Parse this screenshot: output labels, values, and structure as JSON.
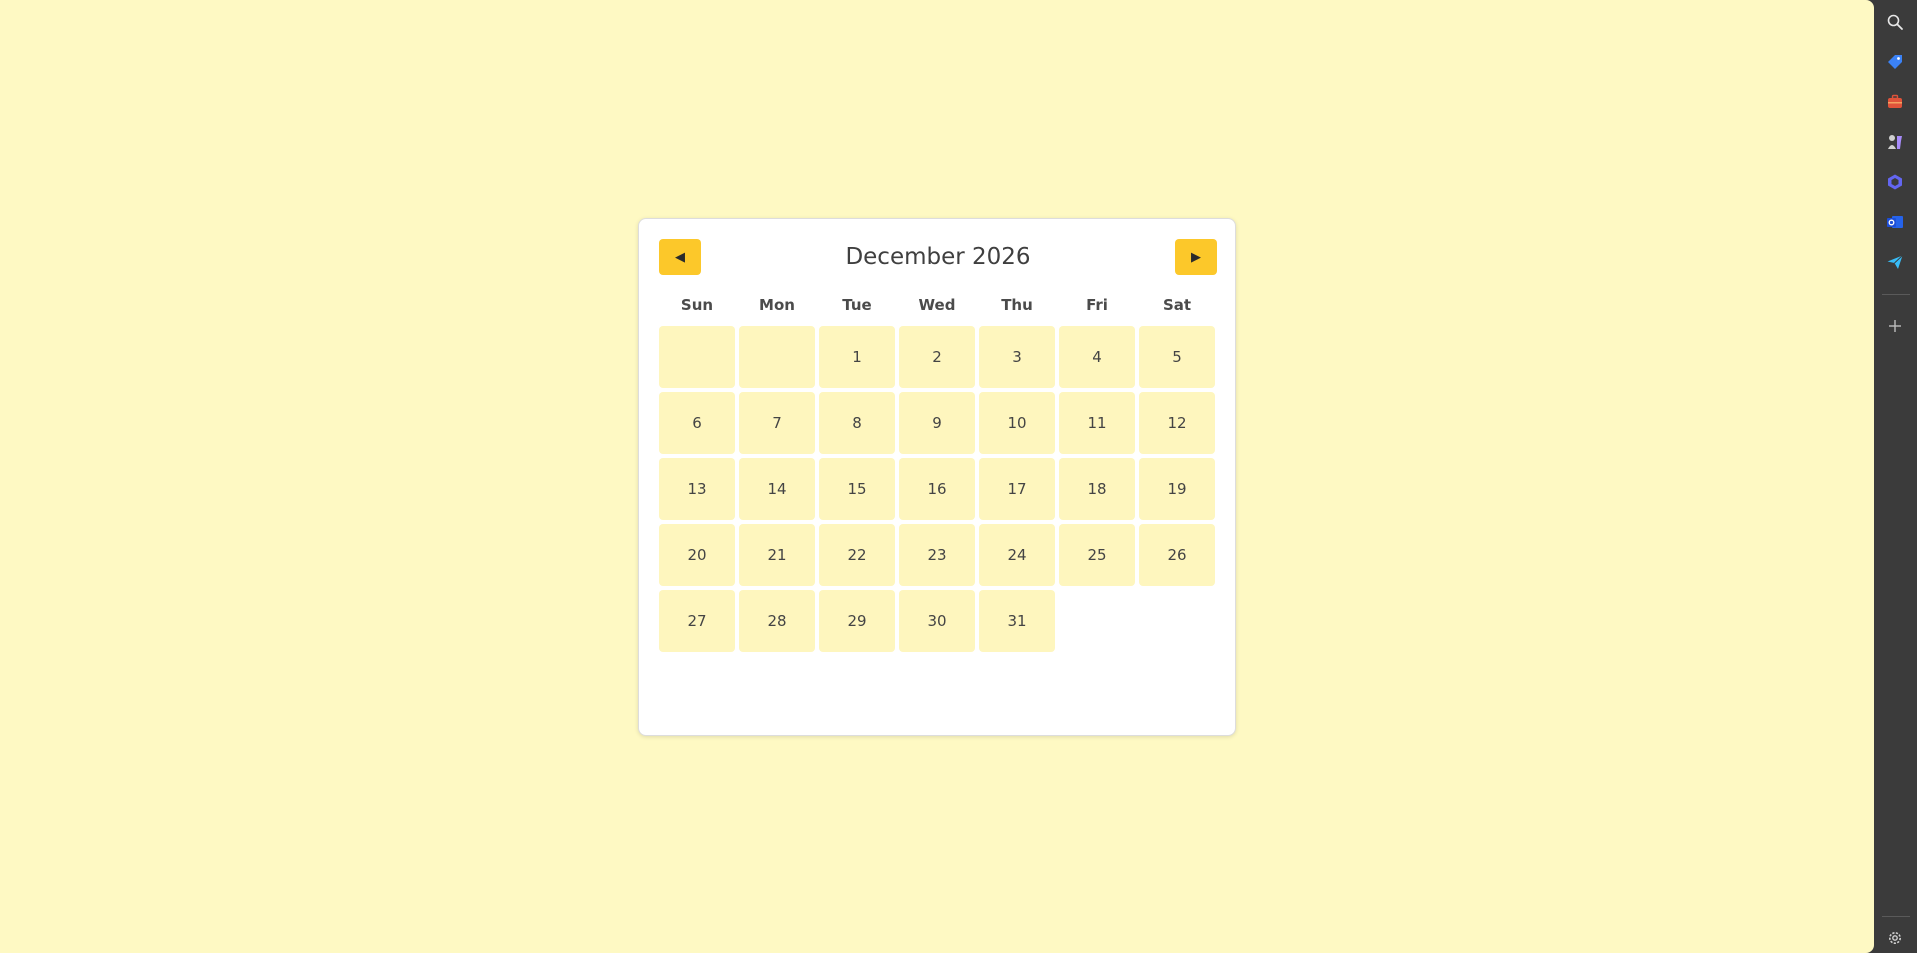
{
  "calendar": {
    "month_title": "December 2026",
    "prev_label": "◀",
    "next_label": "▶",
    "weekdays": [
      "Sun",
      "Mon",
      "Tue",
      "Wed",
      "Thu",
      "Fri",
      "Sat"
    ],
    "days": [
      "",
      "",
      "1",
      "2",
      "3",
      "4",
      "5",
      "6",
      "7",
      "8",
      "9",
      "10",
      "11",
      "12",
      "13",
      "14",
      "15",
      "16",
      "17",
      "18",
      "19",
      "20",
      "21",
      "22",
      "23",
      "24",
      "25",
      "26",
      "27",
      "28",
      "29",
      "30",
      "31"
    ]
  },
  "sidebar": {
    "icons": [
      "search-icon",
      "tag-icon",
      "briefcase-icon",
      "chess-icon",
      "copilot-icon",
      "outlook-icon",
      "send-icon",
      "add-icon",
      "gear-icon"
    ]
  },
  "colors": {
    "page_background": "#fef9c3",
    "day_cell": "#fef6be",
    "nav_button": "#fcc82a",
    "sidebar": "#3b3b3b"
  }
}
